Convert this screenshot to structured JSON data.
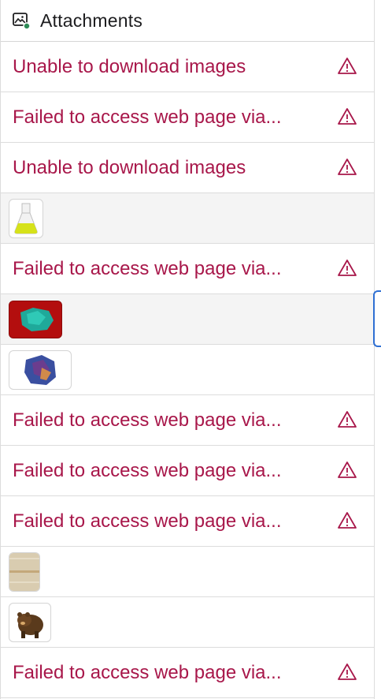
{
  "header": {
    "title": "Attachments",
    "icon": "image-attachment-icon"
  },
  "colors": {
    "error_text": "#a8174a",
    "accent": "#2e6fd3",
    "status_dot": "#2e8b57"
  },
  "rows": [
    {
      "type": "error",
      "text": "Unable to download images"
    },
    {
      "type": "error",
      "text": "Failed to access web page via..."
    },
    {
      "type": "error",
      "text": "Unable to download images"
    },
    {
      "type": "image",
      "icon": "flask-thumbnail"
    },
    {
      "type": "error",
      "text": "Failed to access web page via..."
    },
    {
      "type": "image",
      "icon": "green-mineral-thumbnail"
    },
    {
      "type": "image",
      "icon": "blue-mineral-thumbnail"
    },
    {
      "type": "error",
      "text": "Failed to access web page via..."
    },
    {
      "type": "error",
      "text": "Failed to access web page via..."
    },
    {
      "type": "error",
      "text": "Failed to access web page via..."
    },
    {
      "type": "image",
      "icon": "fabric-swatch-thumbnail"
    },
    {
      "type": "image",
      "icon": "bear-thumbnail"
    },
    {
      "type": "error",
      "text": "Failed to access web page via..."
    }
  ]
}
